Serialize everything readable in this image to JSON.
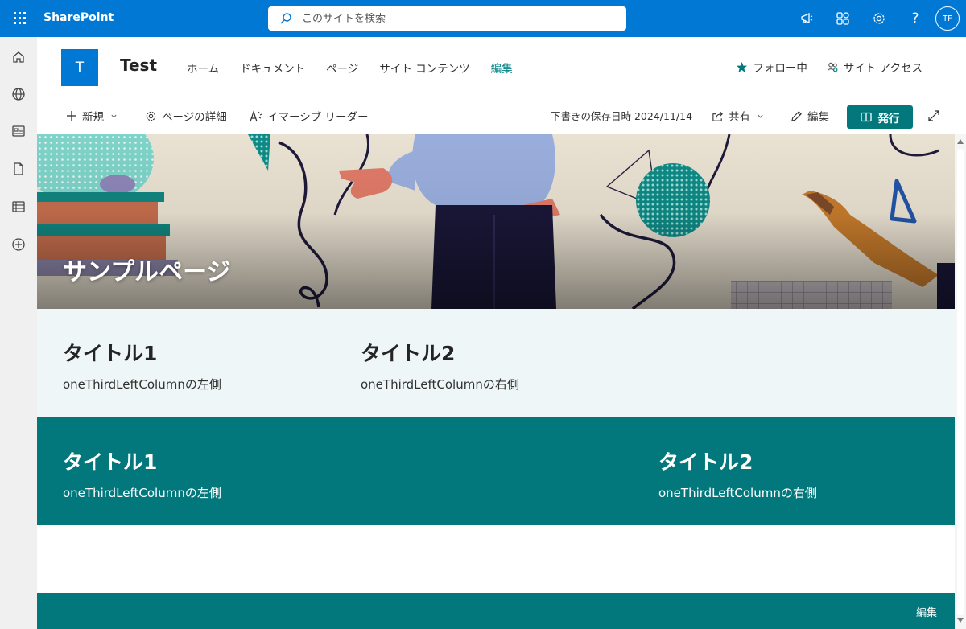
{
  "suite": {
    "brand": "SharePoint",
    "search_placeholder": "このサイトを検索",
    "avatar_initials": "TF",
    "help": "?",
    "accent": "#0078d4"
  },
  "site": {
    "logo_letter": "T",
    "title": "Test",
    "nav": [
      "ホーム",
      "ドキュメント",
      "ページ",
      "サイト コンテンツ",
      "編集"
    ],
    "active_nav": "編集",
    "follow_label": "フォロー中",
    "access_label": "サイト アクセス"
  },
  "commandbar": {
    "new_label": "新規",
    "details_label": "ページの詳細",
    "reader_label": "イマーシブ リーダー",
    "saved_status": "下書きの保存日時 2024/11/14",
    "share_label": "共有",
    "edit_label": "編集",
    "publish_label": "発行"
  },
  "hero": {
    "title": "サンプルページ"
  },
  "section1": {
    "background": "#eef6f7",
    "col1": {
      "heading": "タイトル1",
      "body": "oneThirdLeftColumnの左側"
    },
    "col2": {
      "heading": "タイトル2",
      "body": "oneThirdLeftColumnの右側"
    }
  },
  "section2": {
    "background": "#03787c",
    "col1": {
      "heading": "タイトル1",
      "body": "oneThirdLeftColumnの左側"
    },
    "col2": {
      "heading": "タイトル2",
      "body": "oneThirdLeftColumnの右側"
    }
  },
  "footer": {
    "edit_label": "編集"
  }
}
